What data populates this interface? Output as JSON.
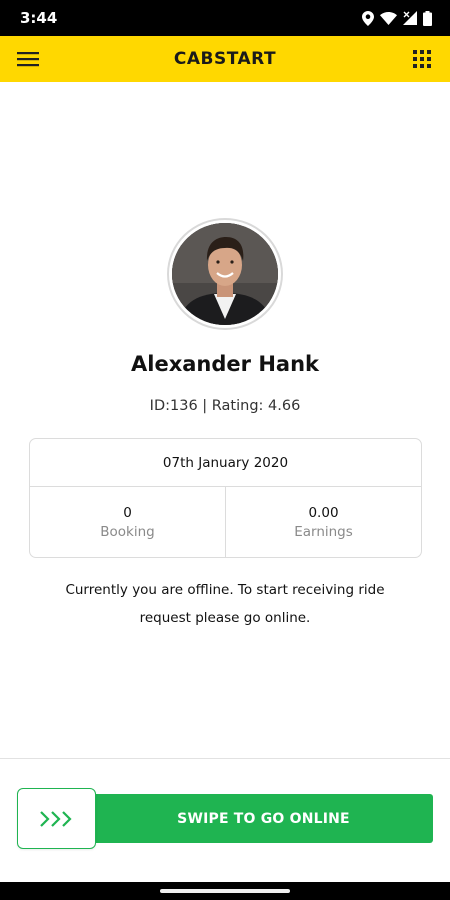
{
  "status_bar": {
    "time": "3:44",
    "icons": [
      "location-icon",
      "wifi-icon",
      "signal-icon",
      "battery-icon"
    ]
  },
  "app_bar": {
    "title": "CABSTART",
    "left_icon": "hamburger-menu-icon",
    "right_icon": "grid-apps-icon",
    "background": "#ffd800"
  },
  "profile": {
    "name": "Alexander Hank",
    "meta": "ID:136 | Rating: 4.66"
  },
  "stats": {
    "date": "07th January 2020",
    "booking_value": "0",
    "booking_label": "Booking",
    "earnings_value": "0.00",
    "earnings_label": "Earnings"
  },
  "message": "Currently you are offline. To start receiving ride request please go online.",
  "swipe": {
    "label": "SWIPE TO GO ONLINE",
    "handle_icon": "triple-chevron-right-icon",
    "color": "#1fb451"
  }
}
